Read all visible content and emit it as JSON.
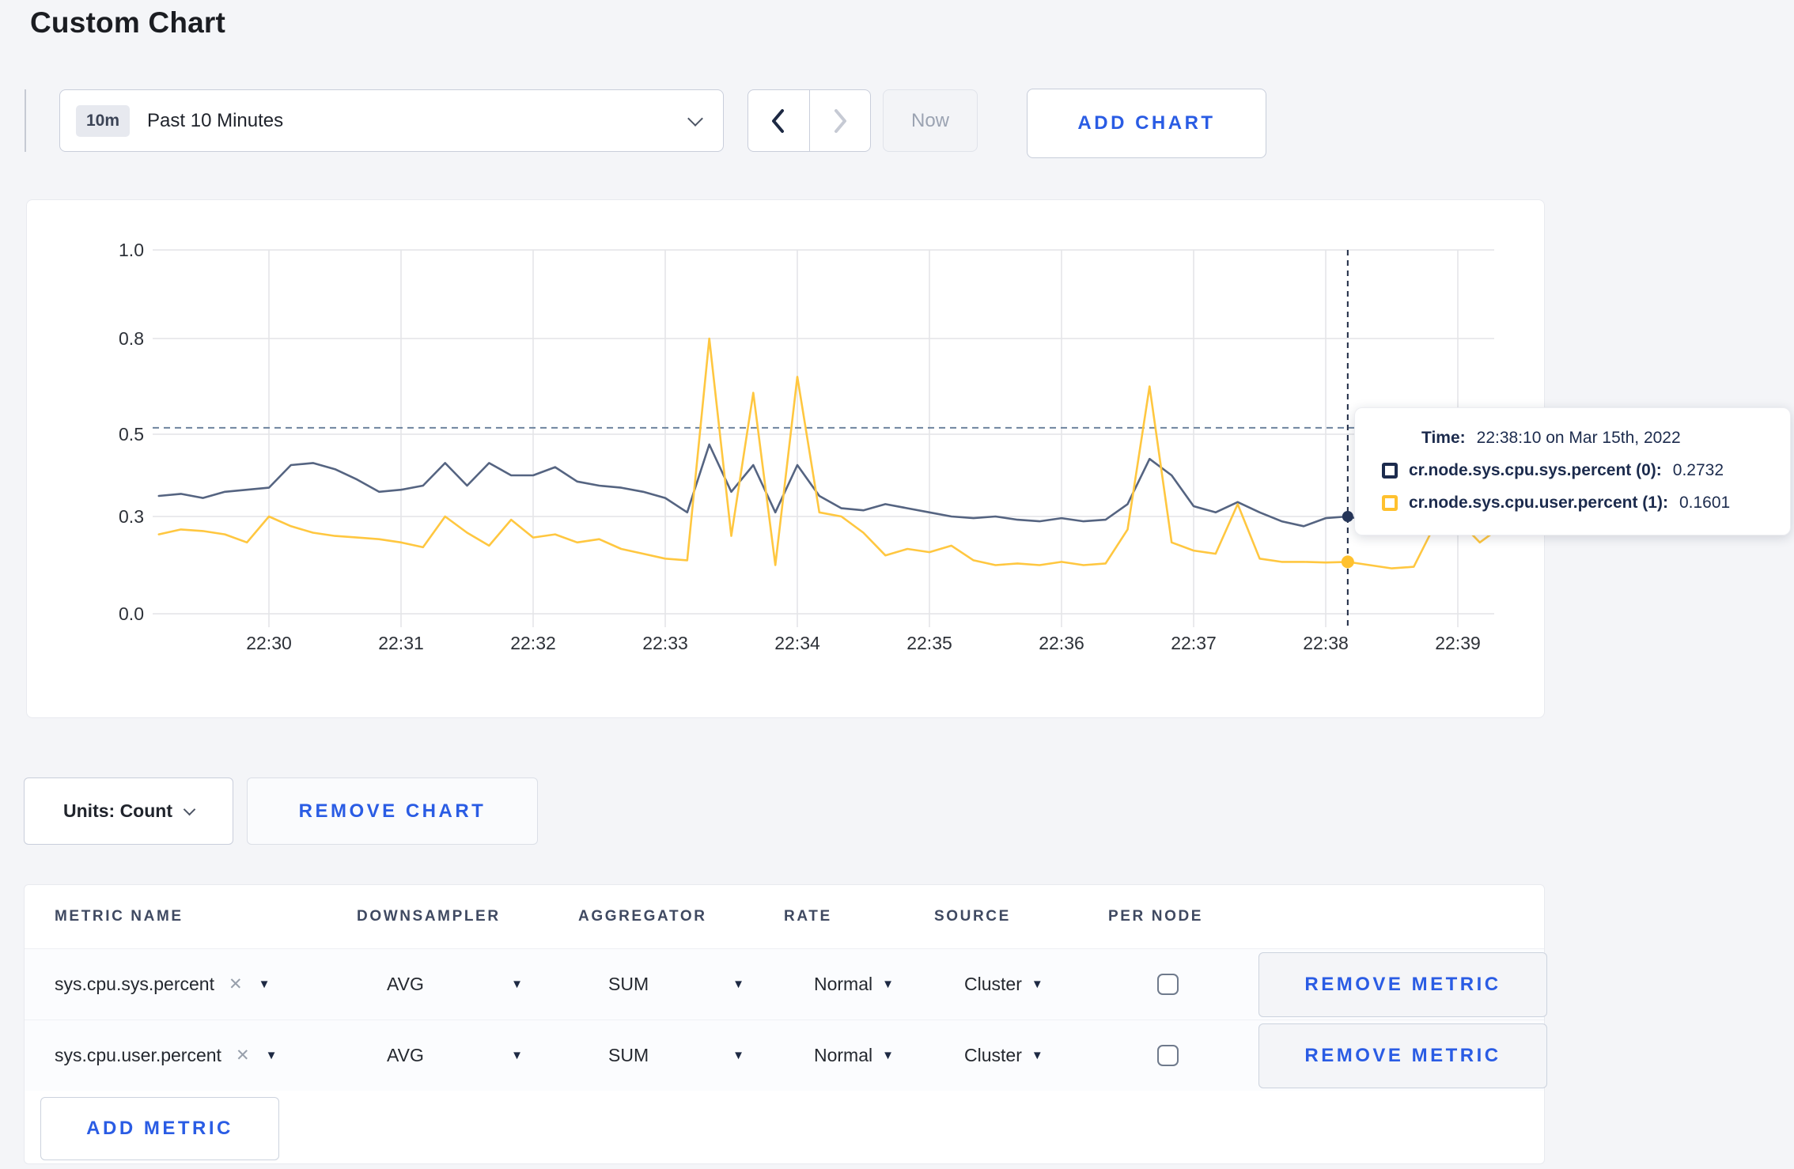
{
  "page": {
    "title": "Custom Chart",
    "accent_blue": "#2a5ce4",
    "background": "#f4f5f8"
  },
  "toolbar": {
    "time_range_badge": "10m",
    "time_range_label": "Past 10 Minutes",
    "now_label": "Now",
    "add_chart_label": "ADD CHART",
    "prev_enabled": true,
    "next_enabled": false
  },
  "chart_data": {
    "type": "line",
    "title": "",
    "xlabel": "",
    "ylabel": "",
    "x_tick_labels": [
      "22:30",
      "22:31",
      "22:32",
      "22:33",
      "22:34",
      "22:35",
      "22:36",
      "22:37",
      "22:38",
      "22:39"
    ],
    "y_ticks": [
      0.0,
      0.3,
      0.5,
      0.8,
      1.0
    ],
    "ylim": [
      0,
      1.0
    ],
    "grid": true,
    "legend_position": "tooltip",
    "start_time": "22:29:10",
    "interval_seconds": 10,
    "guideline_value": 0.52,
    "guideline_color": "#6e849e",
    "crosshair": {
      "index": 54,
      "time": "22:38:10",
      "color": "#1d2943"
    },
    "series": [
      {
        "name": "cr.node.sys.cpu.sys.percent (0)",
        "color": "#556481",
        "dot_color": "#27375a",
        "values": [
          0.35,
          0.355,
          0.345,
          0.36,
          0.365,
          0.37,
          0.425,
          0.43,
          0.415,
          0.39,
          0.36,
          0.365,
          0.375,
          0.43,
          0.375,
          0.43,
          0.4,
          0.4,
          0.42,
          0.385,
          0.375,
          0.37,
          0.36,
          0.345,
          0.31,
          0.475,
          0.36,
          0.425,
          0.31,
          0.425,
          0.35,
          0.32,
          0.315,
          0.33,
          0.32,
          0.31,
          0.3,
          0.295,
          0.3,
          0.29,
          0.285,
          0.295,
          0.285,
          0.29,
          0.33,
          0.44,
          0.4,
          0.325,
          0.31,
          0.335,
          0.31,
          0.285,
          0.27,
          0.295,
          0.3,
          0.285,
          0.3,
          0.31,
          0.3,
          0.295,
          0.3,
          0.3
        ]
      },
      {
        "name": "cr.node.sys.cpu.user.percent (1)",
        "color": "#ffc740",
        "dot_color": "#ffc12e",
        "values": [
          0.245,
          0.26,
          0.255,
          0.245,
          0.22,
          0.3,
          0.27,
          0.25,
          0.24,
          0.235,
          0.23,
          0.22,
          0.205,
          0.3,
          0.25,
          0.21,
          0.29,
          0.235,
          0.245,
          0.22,
          0.23,
          0.2,
          0.185,
          0.17,
          0.165,
          0.8,
          0.24,
          0.63,
          0.15,
          0.68,
          0.31,
          0.3,
          0.25,
          0.18,
          0.2,
          0.19,
          0.21,
          0.165,
          0.15,
          0.155,
          0.15,
          0.16,
          0.15,
          0.155,
          0.26,
          0.65,
          0.22,
          0.195,
          0.185,
          0.33,
          0.17,
          0.16,
          0.16,
          0.158,
          0.16,
          0.15,
          0.14,
          0.145,
          0.28,
          0.29,
          0.22,
          0.27
        ]
      }
    ]
  },
  "tooltip": {
    "time_label": "Time:",
    "time_value": "22:38:10 on Mar 15th, 2022",
    "entries": [
      {
        "name": "cr.node.sys.cpu.sys.percent (0):",
        "value": "0.2732",
        "color": "#1c2b4d"
      },
      {
        "name": "cr.node.sys.cpu.user.percent (1):",
        "value": "0.1601",
        "color": "#ffc12e"
      }
    ]
  },
  "chart_footer": {
    "units_label": "Units: Count",
    "remove_chart_label": "REMOVE CHART"
  },
  "metrics_table": {
    "headers": [
      "METRIC NAME",
      "DOWNSAMPLER",
      "AGGREGATOR",
      "RATE",
      "SOURCE",
      "PER NODE"
    ],
    "rows": [
      {
        "metric_name": "sys.cpu.sys.percent",
        "downsampler": "AVG",
        "aggregator": "SUM",
        "rate": "Normal",
        "source": "Cluster",
        "per_node_checked": false,
        "remove_label": "REMOVE METRIC"
      },
      {
        "metric_name": "sys.cpu.user.percent",
        "downsampler": "AVG",
        "aggregator": "SUM",
        "rate": "Normal",
        "source": "Cluster",
        "per_node_checked": false,
        "remove_label": "REMOVE METRIC"
      }
    ],
    "add_metric_label": "ADD METRIC"
  }
}
